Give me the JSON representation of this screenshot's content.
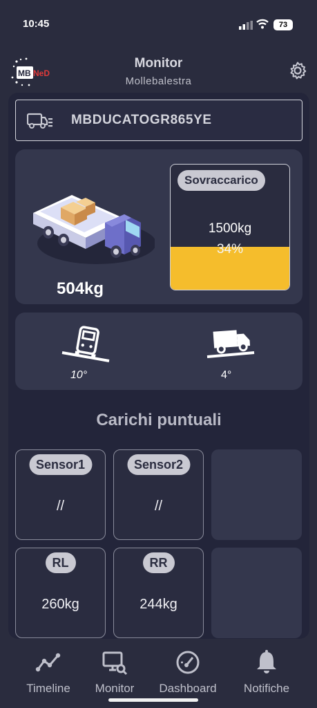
{
  "status_bar": {
    "time": "10:45",
    "battery": "73"
  },
  "header": {
    "title": "Monitor",
    "subtitle": "Mollebalestra",
    "logo_text_left": "MB",
    "logo_text_right": "NeD"
  },
  "vehicle": {
    "plate": "MBDUCATOGR865YE"
  },
  "load": {
    "current": "504kg",
    "badge": "Sovraccarico",
    "capacity": "1500kg",
    "percent_label": "34%",
    "percent_value": 0.34
  },
  "tilt": {
    "roll": "10°",
    "pitch": "4°"
  },
  "section_title": "Carichi puntuali",
  "sensors": [
    {
      "label": "Sensor1",
      "value": "//"
    },
    {
      "label": "Sensor2",
      "value": "//"
    },
    {
      "label": "RL",
      "value": "260kg"
    },
    {
      "label": "RR",
      "value": "244kg"
    }
  ],
  "nav": [
    {
      "label": "Timeline",
      "icon": "timeline-icon"
    },
    {
      "label": "Monitor",
      "icon": "monitor-icon"
    },
    {
      "label": "Dashboard",
      "icon": "dashboard-icon"
    },
    {
      "label": "Notifiche",
      "icon": "bell-icon"
    }
  ],
  "colors": {
    "background": "#2a2c3e",
    "card": "#34374d",
    "fill": "#f5bd2c",
    "badge": "#c9c9d2"
  }
}
